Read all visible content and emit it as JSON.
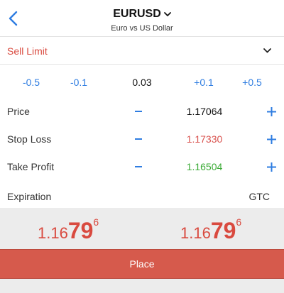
{
  "header": {
    "symbol": "EURUSD",
    "description": "Euro vs US Dollar"
  },
  "order_type": {
    "label": "Sell Limit"
  },
  "volume": {
    "steps_minus": [
      "-0.5",
      "-0.1"
    ],
    "value": "0.03",
    "steps_plus": [
      "+0.1",
      "+0.5"
    ]
  },
  "fields": {
    "price": {
      "label": "Price",
      "value": "1.17064"
    },
    "stop_loss": {
      "label": "Stop Loss",
      "value": "1.17330"
    },
    "take_profit": {
      "label": "Take Profit",
      "value": "1.16504"
    }
  },
  "expiration": {
    "label": "Expiration",
    "value": "GTC"
  },
  "quotes": {
    "bid": {
      "prefix": "1.16",
      "big": "79",
      "sup": "6"
    },
    "ask": {
      "prefix": "1.16",
      "big": "79",
      "sup": "6"
    }
  },
  "actions": {
    "place_label": "Place"
  },
  "colors": {
    "accent": "#2f7de1",
    "sell": "#d94a3f",
    "stop_loss": "#d9534f",
    "take_profit": "#3aaa35",
    "place_button": "#d65a4c"
  }
}
